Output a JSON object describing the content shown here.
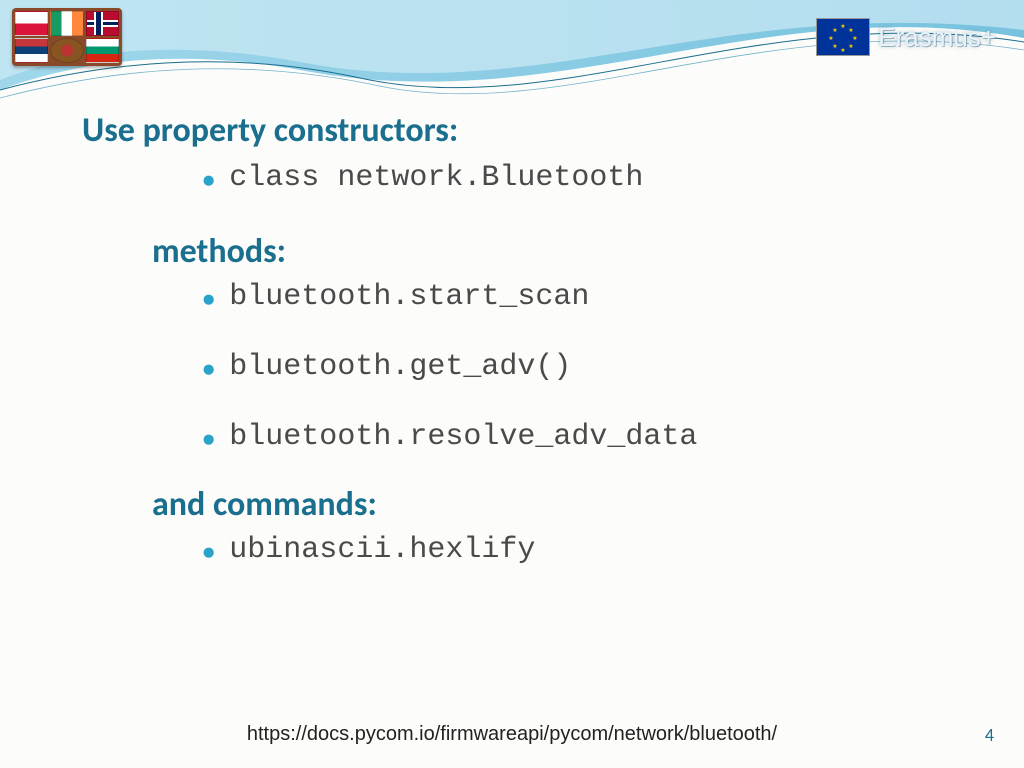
{
  "header": {
    "program_label": "Erasmus+"
  },
  "slide": {
    "title": "Use property constructors:",
    "constructor_items": [
      "class network.Bluetooth"
    ],
    "methods_heading": "methods:",
    "methods_items": [
      "bluetooth.start_scan",
      "bluetooth.get_adv()",
      "bluetooth.resolve_adv_data"
    ],
    "commands_heading": "and commands:",
    "commands_items": [
      "ubinascii.hexlify"
    ]
  },
  "footer": {
    "url": "https://docs.pycom.io/firmwareapi/pycom/network/bluetooth/",
    "page_number": "4"
  },
  "colors": {
    "heading": "#1a6e8e",
    "bullet": "#2aa3c9",
    "wave_light": "#bfe7f5",
    "wave_dark": "#5fb8d9"
  }
}
